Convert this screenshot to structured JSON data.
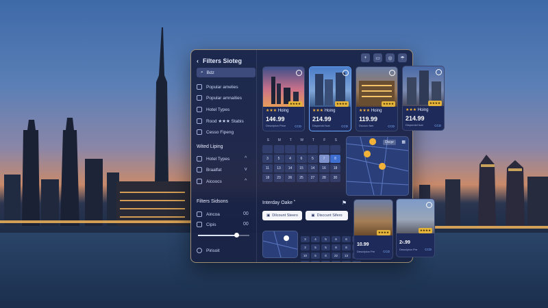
{
  "panel": {
    "title": "Filters Sioteg",
    "search": {
      "value": "Bdz"
    },
    "toolbar": {
      "icons": [
        "plus-icon",
        "window-icon",
        "camera-icon",
        "umbrella-icon"
      ]
    },
    "nav": [
      {
        "label": "Popular amelies",
        "icon": "check-circle-icon"
      },
      {
        "label": "Popular amnaities",
        "icon": "check-circle-icon"
      },
      {
        "label": "Hotel Types",
        "icon": "building-icon"
      },
      {
        "label": "Rood ★★★ Stabis",
        "icon": "settings-icon"
      },
      {
        "label": "Cesso Fipeng",
        "icon": "list-icon"
      }
    ],
    "section1": {
      "title": "Wited Liping"
    },
    "section1_items": [
      {
        "label": "Hotel Types",
        "chev": "^"
      },
      {
        "label": "Braalfat",
        "chev": "v"
      },
      {
        "label": "Aicoocs",
        "chev": "^"
      }
    ],
    "section2": {
      "title": "Filters Sidsons"
    },
    "section2_items": [
      {
        "label": "Aincoa",
        "val": "00"
      },
      {
        "label": "Cipis",
        "val": "00"
      }
    ],
    "slider": {
      "value": 0.75
    },
    "footer": {
      "label": "Pirisoit"
    },
    "cards": [
      {
        "stars": "★★★",
        "rating_badge": "★★★★",
        "name": "Hoing",
        "price": "14¢.99",
        "sub": "Descripion Price",
        "tag": "CCD"
      },
      {
        "stars": "★★★",
        "rating_badge": "★★★★",
        "name": "Hoing",
        "price": "214.99",
        "sub": "Dispondol fuat",
        "tag": "CCD"
      },
      {
        "stars": "★★★",
        "rating_badge": "★★★★",
        "name": "Hoing",
        "price": "119.99",
        "sub": "Dscooo fam",
        "tag": "CCD"
      },
      {
        "stars": "★★★",
        "rating_badge": "★★★★",
        "name": "Hoing",
        "price": "214.99",
        "sub": "Dispondol fuat",
        "tag": "CCD"
      }
    ],
    "cards_bottom": [
      {
        "rating_badge": "★★★★",
        "price": "10.99",
        "sub": "Descripion Pre",
        "tag": "CCD"
      },
      {
        "rating_badge": "★★★★",
        "price": "2‹.99",
        "sub": "Descripion Pre",
        "tag": "CCD"
      }
    ],
    "calendar": {
      "headers": [
        "S",
        "M",
        "T",
        "W",
        "T",
        "F",
        "S"
      ],
      "rows": [
        [
          "",
          "",
          "",
          "",
          "",
          "",
          ""
        ],
        [
          "3",
          "5",
          "4",
          "6",
          "5",
          "7",
          "8"
        ],
        [
          "11",
          "13",
          "14",
          "15",
          "14",
          "16",
          "18"
        ],
        [
          "18",
          "23",
          "26",
          "25",
          "27",
          "28",
          "30"
        ]
      ]
    },
    "map_label": "Dscpr",
    "interday": {
      "label": "Interday Oake ˚"
    },
    "buttons": {
      "discount1": "Dilcount Steero",
      "discount2": "Disccunt Sifero"
    },
    "small_cal": {
      "rows": [
        [
          "3",
          "4",
          "5",
          "6",
          "6",
          "7"
        ],
        [
          "3",
          "5",
          "5",
          "8",
          "8",
          "9"
        ],
        [
          "10",
          "5",
          "8",
          "22",
          "13",
          "15"
        ],
        [
          "20",
          "7",
          "8",
          "23",
          "24",
          "25"
        ]
      ]
    }
  }
}
